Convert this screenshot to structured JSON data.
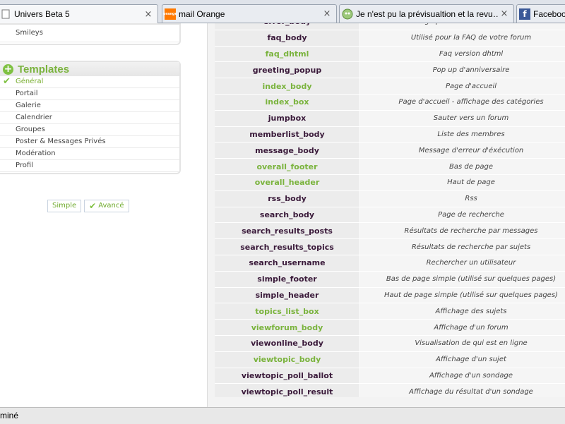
{
  "tabs": [
    {
      "title": "Univers Beta 5",
      "icon": "page-icon",
      "close": "×"
    },
    {
      "title": "mail Orange",
      "icon": "orange-logo-icon",
      "icon_text": "orange",
      "close": "×"
    },
    {
      "title": "Je n'est pu la prévisualtion et la revu…",
      "icon": "forum-icon",
      "close": "×"
    },
    {
      "title": "Faceboo",
      "icon": "facebook-icon",
      "icon_text": "f"
    }
  ],
  "sidebar": {
    "top_item": "Smileys",
    "templates_title": "Templates",
    "templates_items": [
      {
        "label": "Général",
        "active": true
      },
      {
        "label": "Portail"
      },
      {
        "label": "Galerie"
      },
      {
        "label": "Calendrier"
      },
      {
        "label": "Groupes"
      },
      {
        "label": "Poster & Messages Privés"
      },
      {
        "label": "Modération"
      },
      {
        "label": "Profil"
      }
    ],
    "mode_simple": "Simple",
    "mode_advanced": "Avancé"
  },
  "templates": [
    {
      "name": "error_body",
      "desc": "Page pour les erreurs de début",
      "color": "dark"
    },
    {
      "name": "faq_body",
      "desc": "Utilisé pour la FAQ de votre forum",
      "color": "dark"
    },
    {
      "name": "faq_dhtml",
      "desc": "Faq version dhtml",
      "color": "green"
    },
    {
      "name": "greeting_popup",
      "desc": "Pop up d'anniversaire",
      "color": "dark"
    },
    {
      "name": "index_body",
      "desc": "Page d'accueil",
      "color": "green"
    },
    {
      "name": "index_box",
      "desc": "Page d'accueil - affichage des catégories",
      "color": "green"
    },
    {
      "name": "jumpbox",
      "desc": "Sauter vers un forum",
      "color": "dark"
    },
    {
      "name": "memberlist_body",
      "desc": "Liste des membres",
      "color": "dark"
    },
    {
      "name": "message_body",
      "desc": "Message d'erreur d'éxécution",
      "color": "dark"
    },
    {
      "name": "overall_footer",
      "desc": "Bas de page",
      "color": "green"
    },
    {
      "name": "overall_header",
      "desc": "Haut de page",
      "color": "green"
    },
    {
      "name": "rss_body",
      "desc": "Rss",
      "color": "dark"
    },
    {
      "name": "search_body",
      "desc": "Page de recherche",
      "color": "dark"
    },
    {
      "name": "search_results_posts",
      "desc": "Résultats de recherche par messages",
      "color": "dark"
    },
    {
      "name": "search_results_topics",
      "desc": "Résultats de recherche par sujets",
      "color": "dark"
    },
    {
      "name": "search_username",
      "desc": "Rechercher un utilisateur",
      "color": "dark"
    },
    {
      "name": "simple_footer",
      "desc": "Bas de page simple (utilisé sur quelques pages)",
      "color": "dark"
    },
    {
      "name": "simple_header",
      "desc": "Haut de page simple (utilisé sur quelques pages)",
      "color": "dark"
    },
    {
      "name": "topics_list_box",
      "desc": "Affichage des sujets",
      "color": "green"
    },
    {
      "name": "viewforum_body",
      "desc": "Affichage d'un forum",
      "color": "green"
    },
    {
      "name": "viewonline_body",
      "desc": "Visualisation de qui est en ligne",
      "color": "dark"
    },
    {
      "name": "viewtopic_body",
      "desc": "Affichage d'un sujet",
      "color": "green"
    },
    {
      "name": "viewtopic_poll_ballot",
      "desc": "Affichage d'un sondage",
      "color": "dark"
    },
    {
      "name": "viewtopic_poll_result",
      "desc": "Affichage du résultat d'un sondage",
      "color": "dark"
    }
  ],
  "status_text": "miné"
}
